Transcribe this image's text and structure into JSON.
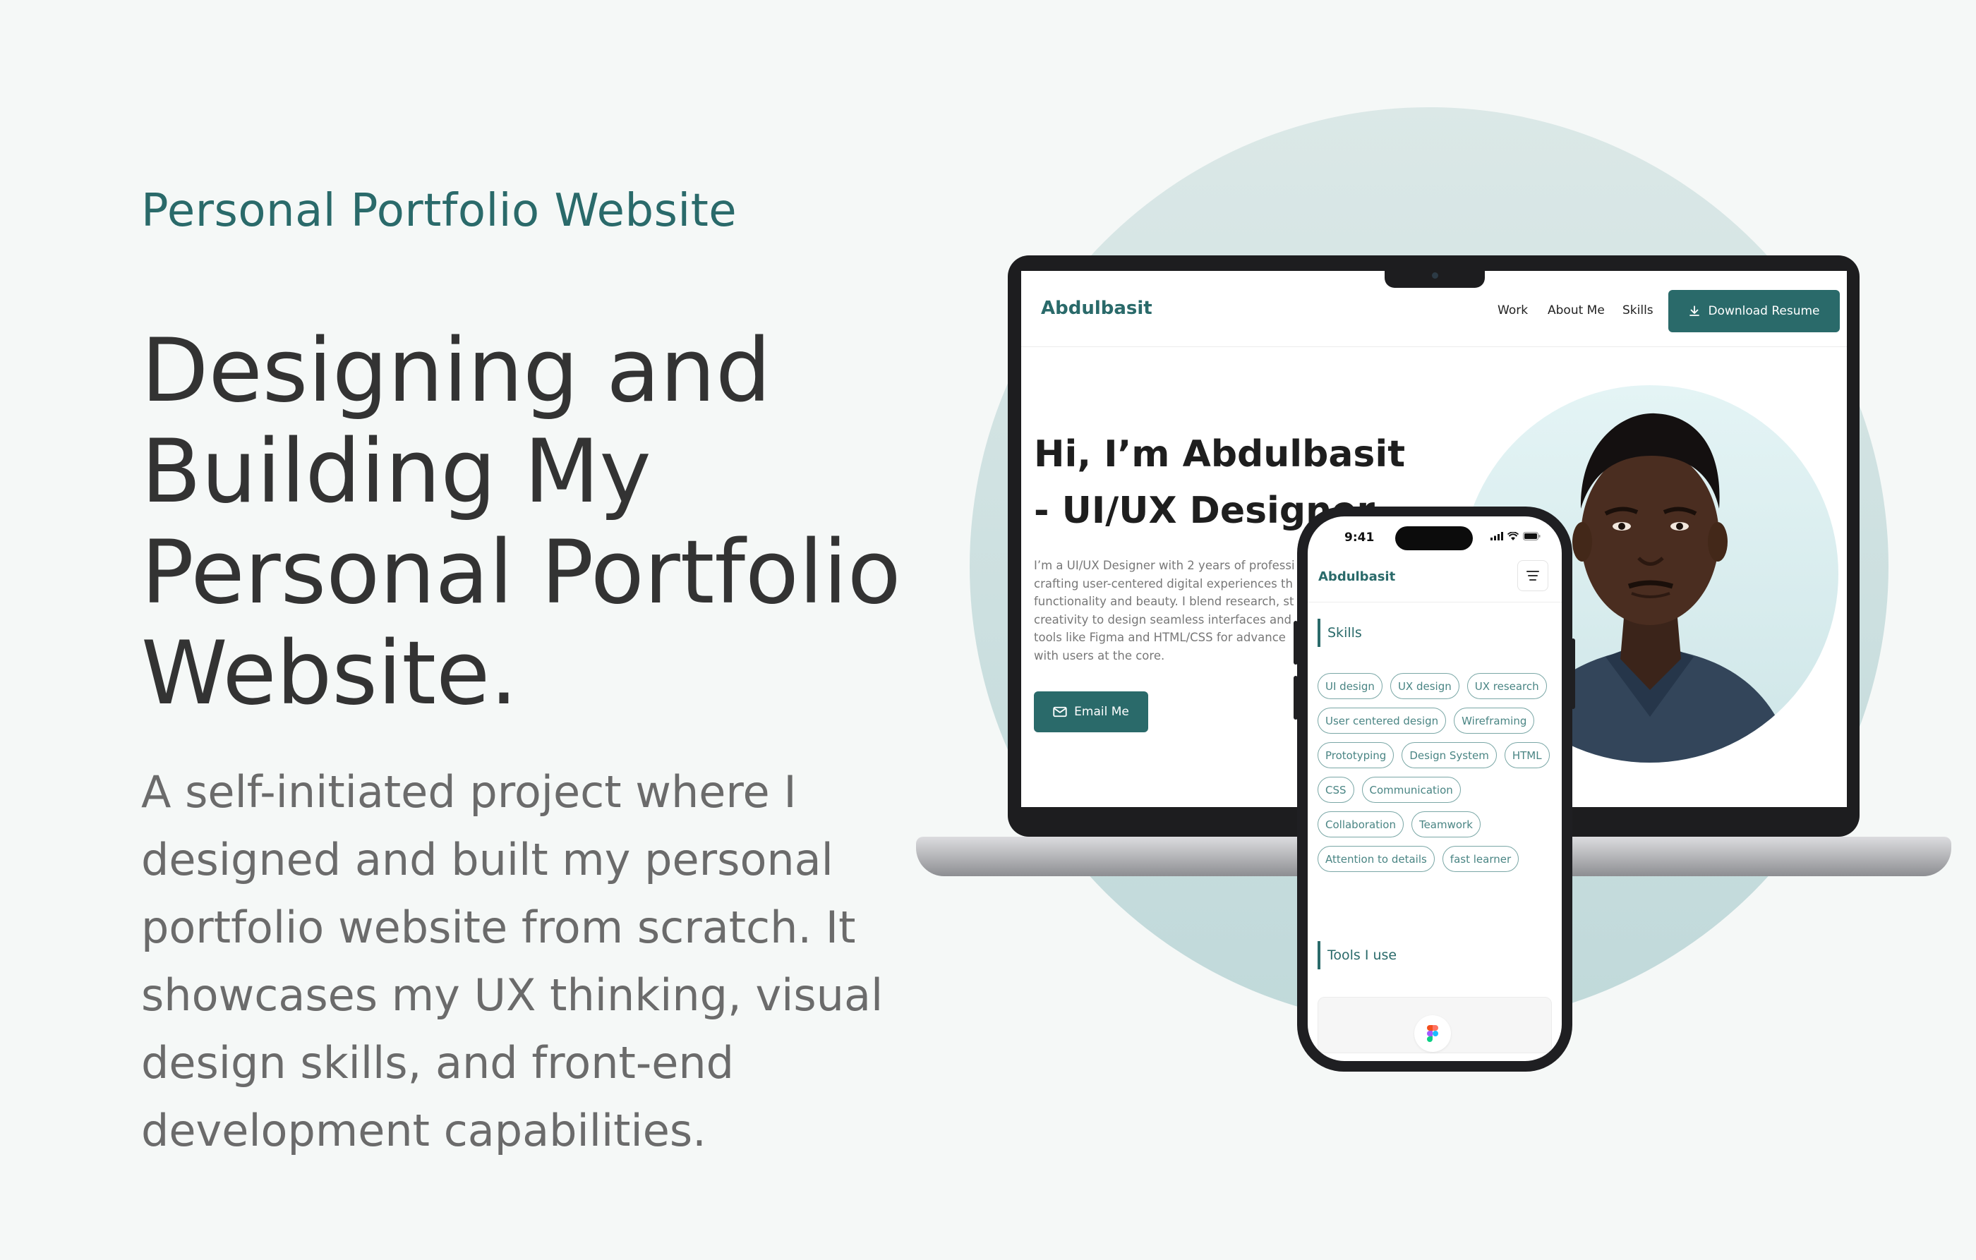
{
  "page": {
    "eyebrow": "Personal Portfolio Website",
    "headline": "Designing and Building My Personal Portfolio Website.",
    "subtext": "A self-initiated project where I designed and built my personal portfolio website from scratch. It showcases my UX thinking, visual design skills, and front-end development capabilities."
  },
  "laptop_site": {
    "logo": "Abdulbasit",
    "nav": [
      "Work",
      "About Me",
      "Skills"
    ],
    "download_button": "Download Resume",
    "hero_title": "Hi, I’m Abdulbasit - UI/UX Designer",
    "hero_paragraph_lines": [
      "I’m a UI/UX Designer with 2 years of professi",
      "crafting user-centered digital experiences th",
      "functionality and beauty. I blend research, st",
      "creativity to design seamless interfaces and",
      "tools like Figma and HTML/CSS for advance",
      "with users at the core."
    ],
    "email_button": "Email Me"
  },
  "phone_site": {
    "time": "9:41",
    "logo": "Abdulbasit",
    "skills_heading": "Skills",
    "skills": [
      "UI design",
      "UX design",
      "UX research",
      "User centered design",
      "Wireframing",
      "Prototyping",
      "Design System",
      "HTML",
      "CSS",
      "Communication",
      "Collaboration",
      "Teamwork",
      "Attention to details",
      "fast learner"
    ],
    "tools_heading": "Tools I use"
  },
  "colors": {
    "accent": "#2a6a6a",
    "background": "#f5f8f7",
    "circle_top": "#dbe8e7",
    "circle_bottom": "#c0d9da",
    "heading_text": "#333333",
    "body_text": "#6b6b6b"
  },
  "icons": [
    "download-icon",
    "mail-icon",
    "hamburger-menu-icon",
    "signal-icon",
    "wifi-icon",
    "battery-icon",
    "figma-icon",
    "portrait-photo"
  ]
}
